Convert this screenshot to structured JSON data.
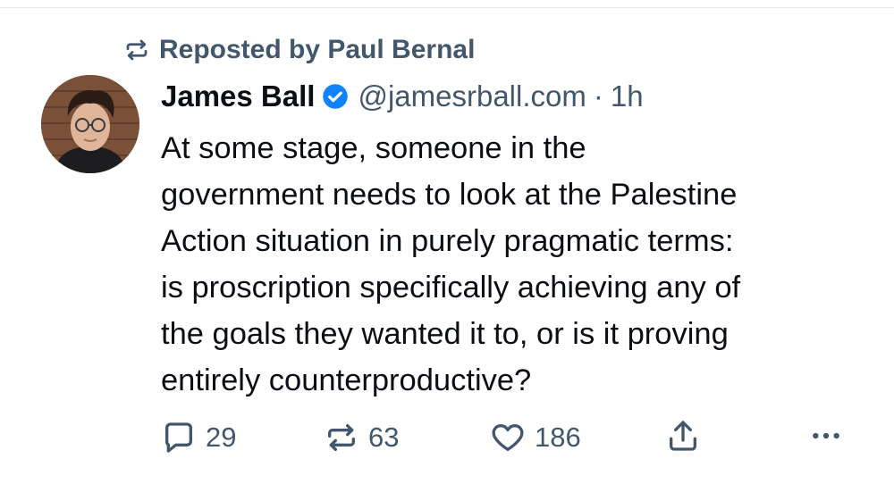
{
  "repost_banner": {
    "text": "Reposted by Paul Bernal",
    "icon": "repost-icon"
  },
  "author": {
    "name": "James Ball",
    "verified": true,
    "handle": "@jamesrball.com",
    "separator": "·",
    "time": "1h"
  },
  "post": {
    "text": "At some stage, someone in the\ngovernment needs to look at the Palestine\nAction situation in purely pragmatic terms:\nis proscription specifically achieving any of\nthe goals they wanted it to, or is it proving\nentirely counterproductive?"
  },
  "actions": {
    "replies": "29",
    "reposts": "63",
    "likes": "186"
  },
  "colors": {
    "text": "#0b0f14",
    "muted": "#42576c",
    "verified_badge": "#1083fe",
    "divider": "#e6eaee"
  }
}
